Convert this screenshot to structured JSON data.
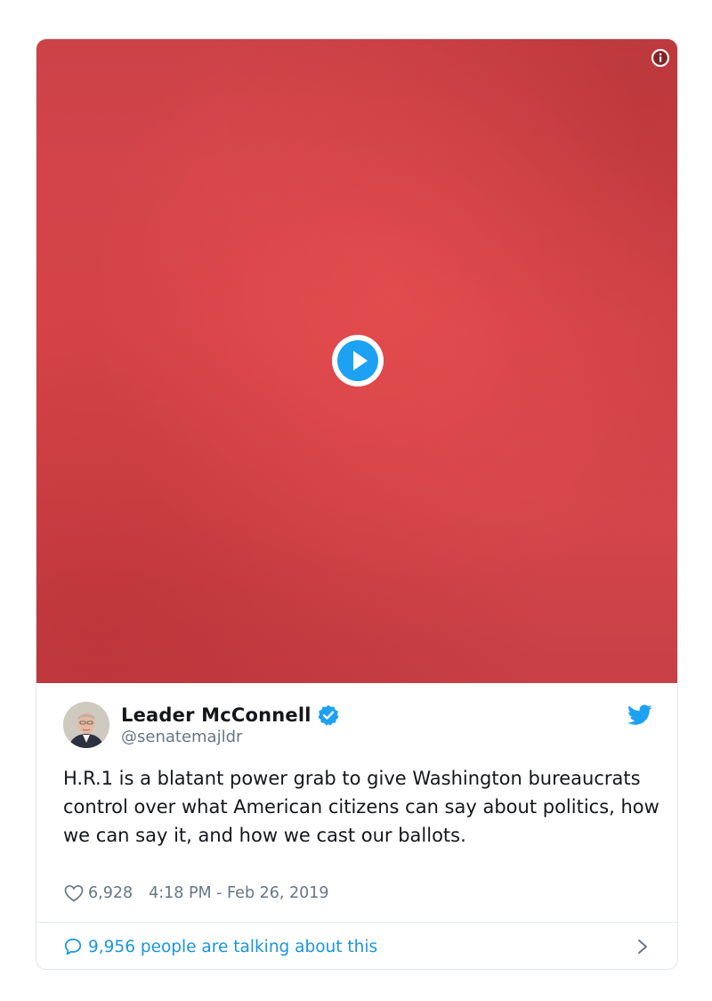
{
  "tweet": {
    "author_name": "Leader McConnell",
    "handle": "@senatemajldr",
    "text": "H.R.1 is a blatant power grab to give Washington bureaucrats control over what American citizens can say about politics, how we can say it, and how we cast our ballots.",
    "likes": "6,928",
    "timestamp": "4:18 PM - Feb 26, 2019",
    "talking_text": "9,956 people are talking about this"
  },
  "icons": {
    "info": "info-icon",
    "play": "play-icon",
    "verified": "verified-badge-icon",
    "brand": "twitter-bird-icon",
    "like": "heart-icon",
    "reply": "speech-bubble-icon",
    "chevron": "chevron-right-icon"
  },
  "colors": {
    "media_background": "#d3454a",
    "link_blue": "#1b95e0",
    "verified_blue": "#1da1f2",
    "secondary_text": "#657786",
    "border": "#e1e8ed"
  }
}
